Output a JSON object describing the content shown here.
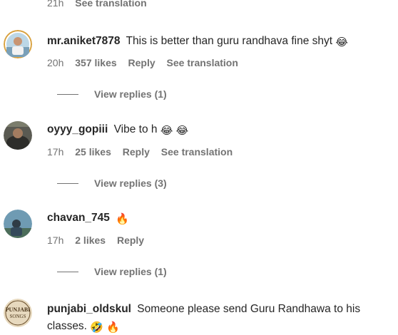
{
  "top": {
    "time": "21h",
    "see_translation": "See translation"
  },
  "comments": [
    {
      "username": "mr.aniket7878",
      "text": "This is better than guru randhava fine shyt",
      "emojis": [
        "😂"
      ],
      "time": "20h",
      "likes": "357 likes",
      "reply": "Reply",
      "see_translation": "See translation",
      "view_replies": "View replies (1)"
    },
    {
      "username": "oyyy_gopiii",
      "text": "Vibe to h",
      "emojis": [
        "😂",
        "😂"
      ],
      "time": "17h",
      "likes": "25 likes",
      "reply": "Reply",
      "see_translation": "See translation",
      "view_replies": "View replies (3)"
    },
    {
      "username": "chavan_745",
      "text": "",
      "emojis": [
        "🔥"
      ],
      "time": "17h",
      "likes": "2 likes",
      "reply": "Reply",
      "view_replies": "View replies (1)"
    },
    {
      "username": "punjabi_oldskul",
      "text": "Someone please send Guru Randhawa to his classes.",
      "emojis": [
        "🤣",
        "🔥"
      ],
      "avatar_text": "PUNJABI SONGS"
    }
  ],
  "colors": {
    "text": "#262626",
    "secondary": "#737373",
    "accent_ring": "#e1306c"
  }
}
